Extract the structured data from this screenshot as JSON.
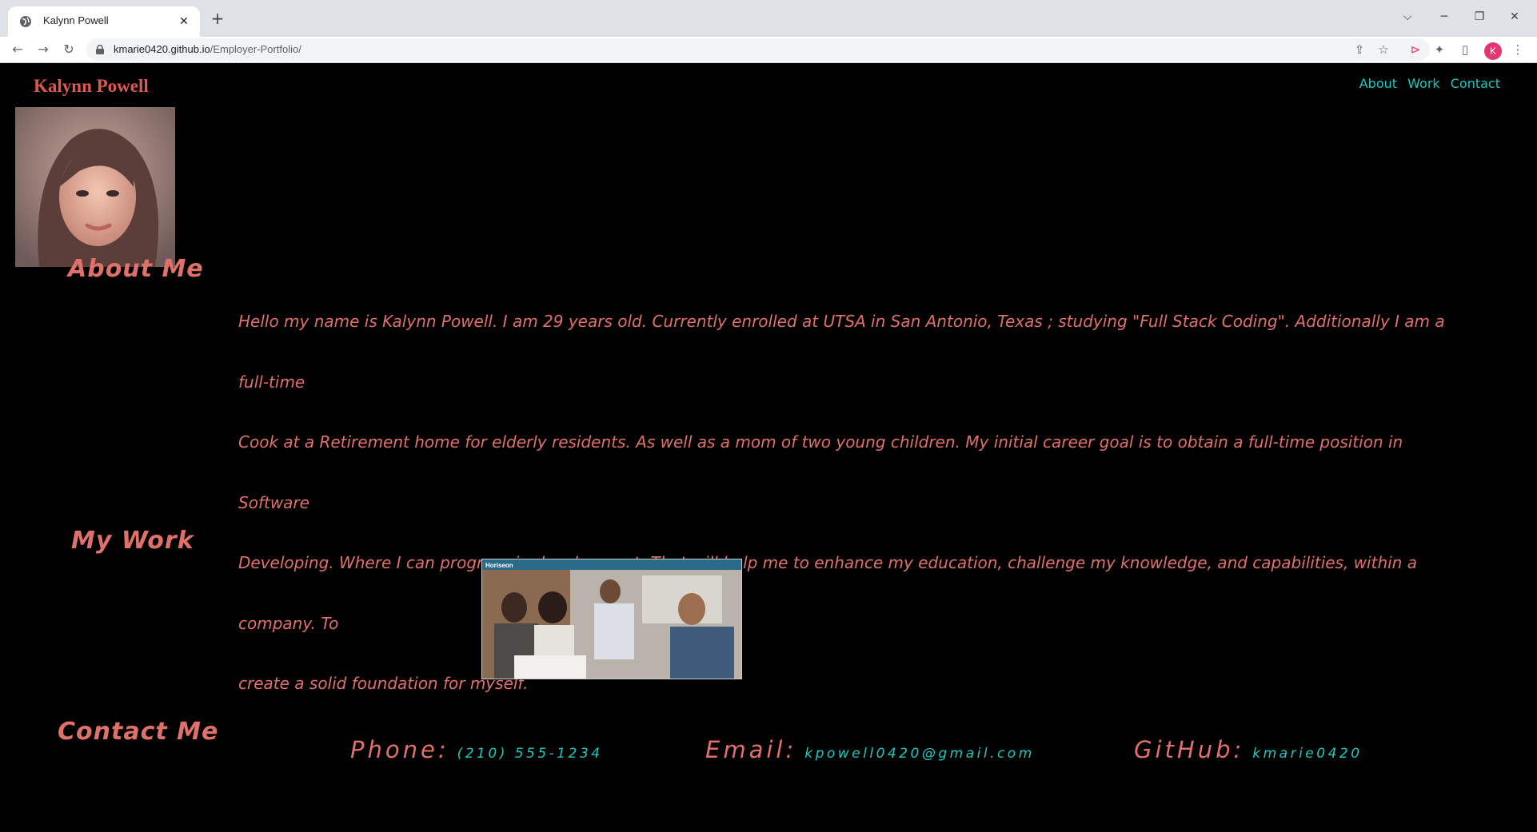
{
  "browser": {
    "tab_title": "Kalynn Powell",
    "new_tab": "+",
    "url_host": "kmarie0420.github.io",
    "url_path": "/Employer-Portfolio/",
    "profile_initial": "K"
  },
  "site": {
    "name": "Kalynn Powell",
    "nav": [
      "About",
      "Work",
      "Contact"
    ]
  },
  "about": {
    "heading": "About Me",
    "lines": [
      "Hello my name is Kalynn Powell. I am 29 years old. Currently enrolled at UTSA in San Antonio, Texas ; studying \"Full Stack Coding\". Additionally I am a full-time",
      "Cook at a Retirement home for elderly residents. As well as a mom of two young children. My initial career goal is to obtain a full-time position in Software",
      "Developing. Where I can progress in development: That will help me to enhance my education, challenge my knowledge, and capabilities, within a company. To",
      "create a solid foundation for myself."
    ]
  },
  "work": {
    "heading": "My Work",
    "thumbnail_brand": "Horiseon"
  },
  "contact": {
    "heading": "Contact Me",
    "phone_label": "Phone:",
    "phone_value": "(210) 555-1234",
    "email_label": "Email:",
    "email_value": "kpowell0420@gmail.com",
    "github_label": "GitHub:",
    "github_value": "kmarie0420"
  },
  "colors": {
    "accent_red": "#e0706a",
    "accent_teal": "#1fc7c1",
    "background": "#000000"
  }
}
